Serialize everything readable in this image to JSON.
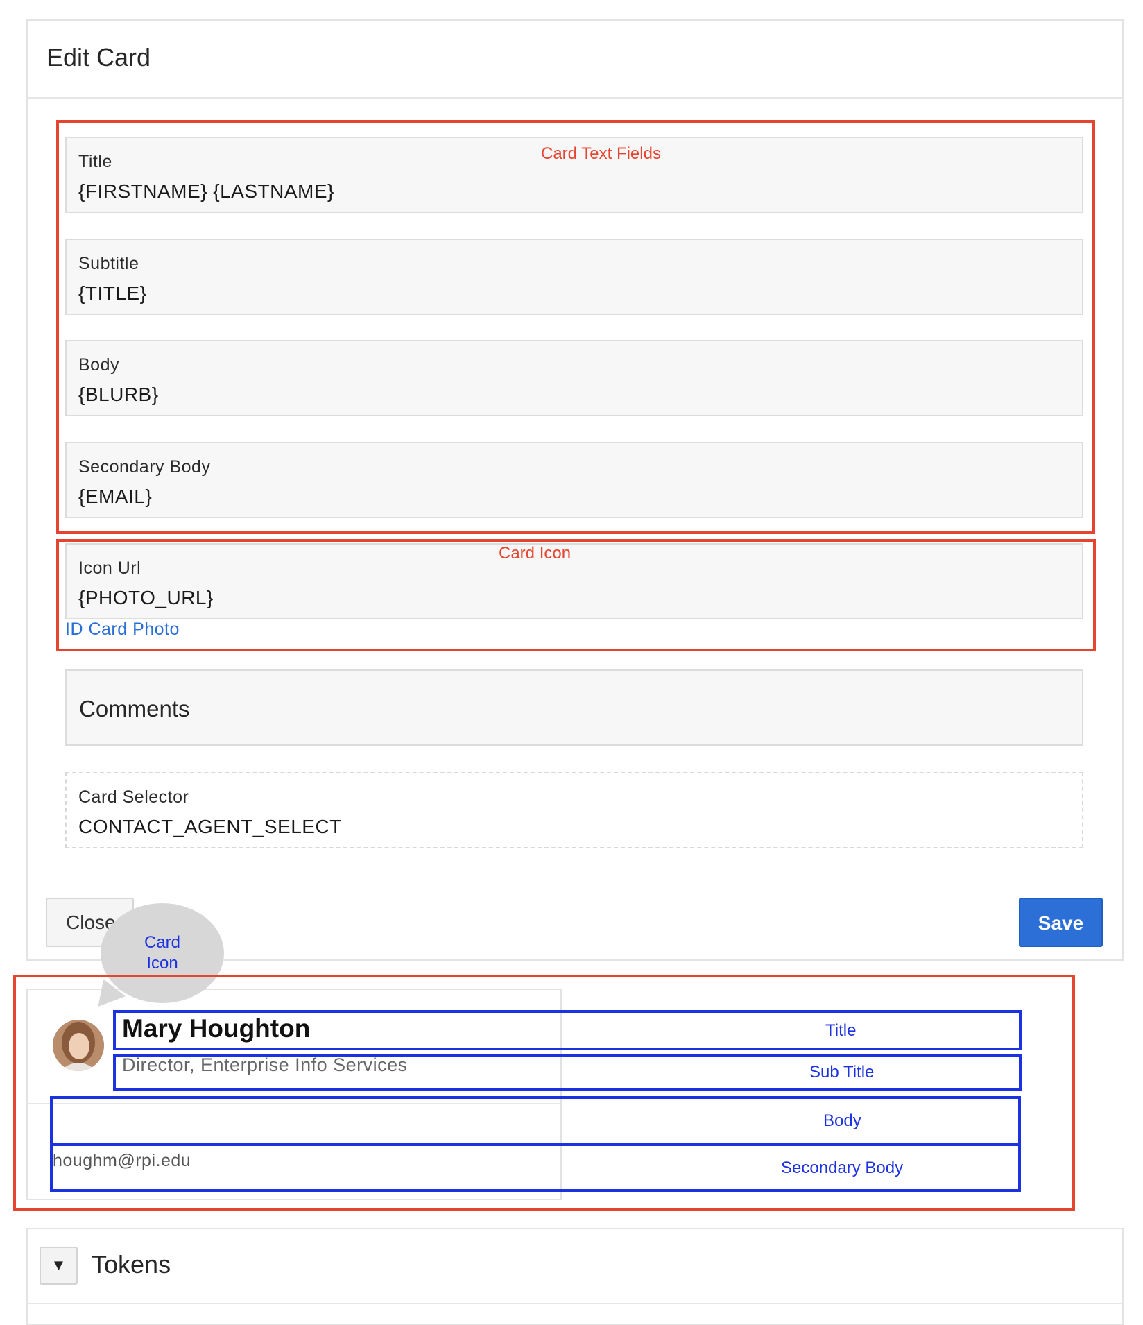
{
  "edit_card": {
    "title": "Edit Card",
    "fields": [
      {
        "label": "Title",
        "value": "{FIRSTNAME} {LASTNAME}"
      },
      {
        "label": "Subtitle",
        "value": "{TITLE}"
      },
      {
        "label": "Body",
        "value": "{BLURB}"
      },
      {
        "label": "Secondary Body",
        "value": "{EMAIL}"
      },
      {
        "label": "Icon Url",
        "value": "{PHOTO_URL}"
      }
    ],
    "icon_helper_link": "ID Card Photo",
    "comments_label": "Comments",
    "card_selector": {
      "label": "Card Selector",
      "value": "CONTACT_AGENT_SELECT"
    },
    "close_label": "Close",
    "save_label": "Save"
  },
  "annotations": {
    "card_text_fields": "Card Text Fields",
    "card_icon": "Card Icon",
    "bubble_line1": "Card",
    "bubble_line2": "Icon",
    "title": "Title",
    "sub_title": "Sub Title",
    "body": "Body",
    "secondary_body": "Secondary Body"
  },
  "preview": {
    "name": "Mary Houghton",
    "subtitle": "Director, Enterprise Info Services",
    "email": "houghm@rpi.edu"
  },
  "tokens": {
    "label": "Tokens",
    "toggle_icon": "caret-down-icon"
  },
  "colors": {
    "annotation_red": "#e5452f",
    "annotation_blue": "#1c32e0",
    "save_button": "#2b6fd7",
    "link": "#2a6fd6"
  }
}
